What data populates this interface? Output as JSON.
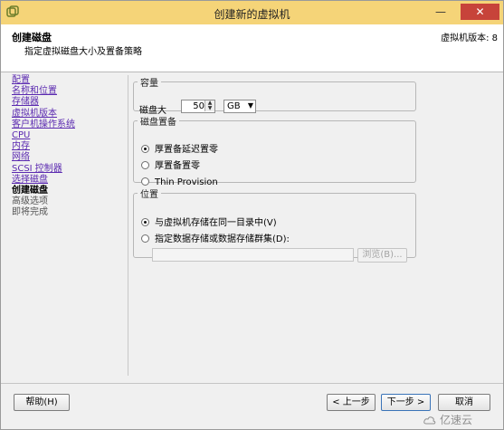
{
  "window": {
    "title": "创建新的虚拟机",
    "minimize_glyph": "—",
    "close_glyph": "✕",
    "accent_color": "#f5d478"
  },
  "header": {
    "title": "创建磁盘",
    "subtitle": "指定虚拟磁盘大小及置备策略",
    "version": "虚拟机版本: 8"
  },
  "nav": {
    "items": [
      {
        "label": "配置",
        "state": "link"
      },
      {
        "label": "名称和位置",
        "state": "link"
      },
      {
        "label": "存储器",
        "state": "link"
      },
      {
        "label": "虚拟机版本",
        "state": "link"
      },
      {
        "label": "客户机操作系统",
        "state": "link"
      },
      {
        "label": "CPU",
        "state": "link"
      },
      {
        "label": "内存",
        "state": "link"
      },
      {
        "label": "网络",
        "state": "link"
      },
      {
        "label": "SCSI 控制器",
        "state": "link"
      },
      {
        "label": "选择磁盘",
        "state": "link"
      },
      {
        "label": "创建磁盘",
        "state": "current"
      },
      {
        "label": "高级选项",
        "state": "future"
      },
      {
        "label": "即将完成",
        "state": "future"
      }
    ]
  },
  "capacity": {
    "legend": "容量",
    "size_label": "磁盘大",
    "size_value": "50",
    "unit": "GB"
  },
  "provisioning": {
    "legend": "磁盘置备",
    "options": [
      {
        "label": "厚置备延迟置零",
        "checked": true
      },
      {
        "label": "厚置备置零",
        "checked": false
      },
      {
        "label": "Thin Provision",
        "checked": false
      }
    ]
  },
  "location": {
    "legend": "位置",
    "option_same": "与虚拟机存储在同一目录中(V)",
    "option_datastore": "指定数据存储或数据存储群集(D):",
    "path_value": "",
    "browse_label": "浏览(B)..."
  },
  "footer": {
    "help": "帮助(H)",
    "back": "< 上一步",
    "next": "下一步 >",
    "cancel": "取消"
  },
  "watermark": {
    "text": "亿速云"
  }
}
